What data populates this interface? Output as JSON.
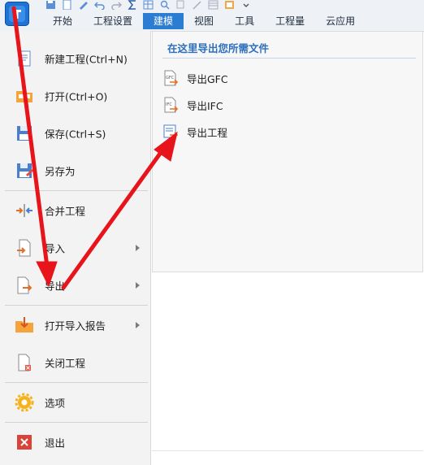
{
  "ribbon": {
    "tabs": [
      "开始",
      "工程设置",
      "建模",
      "视图",
      "工具",
      "工程量",
      "云应用"
    ],
    "active_tab": "建模"
  },
  "menu": {
    "items": [
      {
        "label": "新建工程(Ctrl+N)",
        "icon": "new-project-icon"
      },
      {
        "label": "打开(Ctrl+O)",
        "icon": "open-folder-icon"
      },
      {
        "label": "保存(Ctrl+S)",
        "icon": "save-icon"
      },
      {
        "label": "另存为",
        "icon": "save-as-icon"
      },
      {
        "label": "合并工程",
        "icon": "merge-icon"
      },
      {
        "label": "导入",
        "icon": "import-icon"
      },
      {
        "label": "导出",
        "icon": "export-icon"
      },
      {
        "label": "打开导入报告",
        "icon": "import-report-icon"
      },
      {
        "label": "关闭工程",
        "icon": "close-project-icon"
      },
      {
        "label": "选项",
        "icon": "options-gear-icon"
      },
      {
        "label": "退出",
        "icon": "exit-icon"
      }
    ]
  },
  "export_panel": {
    "title": "在这里导出您所需文件",
    "items": [
      {
        "label": "导出GFC",
        "icon": "gfc-file-icon"
      },
      {
        "label": "导出IFC",
        "icon": "ifc-file-icon"
      },
      {
        "label": "导出工程",
        "icon": "export-project-icon"
      }
    ]
  },
  "colors": {
    "accent": "#2b7cd3",
    "annotation_arrow": "#e8141b",
    "panel_title": "#2c6fbd"
  }
}
